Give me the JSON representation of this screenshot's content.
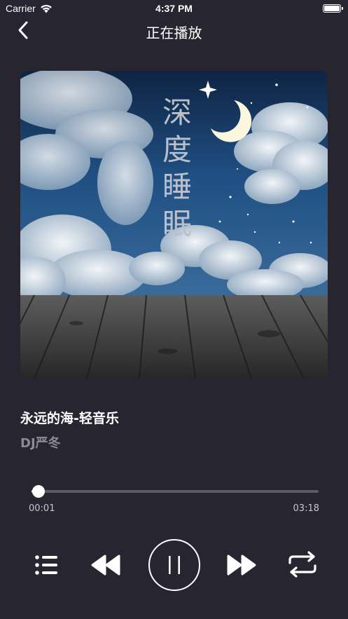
{
  "status_bar": {
    "carrier": "Carrier",
    "time": "4:37 PM",
    "wifi_icon": "wifi-icon",
    "battery_icon": "battery-icon"
  },
  "nav": {
    "title": "正在播放",
    "back_icon": "chevron-left-icon"
  },
  "album": {
    "cover_text": [
      "深",
      "度",
      "睡",
      "眠"
    ]
  },
  "song": {
    "title": "永远的海-轻音乐",
    "artist": "DJ严冬"
  },
  "progress": {
    "current": "00:01",
    "total": "03:18",
    "fraction": 0.005
  },
  "controls": {
    "playlist_icon": "list-icon",
    "prev_icon": "rewind-icon",
    "play_pause_icon": "pause-icon",
    "next_icon": "fast-forward-icon",
    "repeat_icon": "repeat-icon"
  },
  "colors": {
    "background": "#272530",
    "text_secondary": "#8b8a93",
    "track": "#5c5b63",
    "accent": "#ffffff"
  }
}
